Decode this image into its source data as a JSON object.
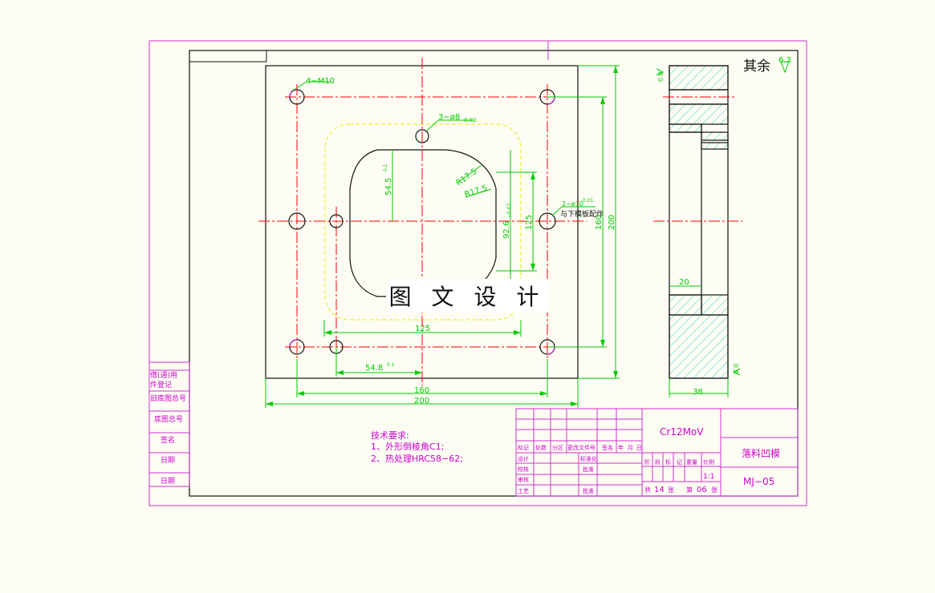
{
  "colors": {
    "background": "#fdfdf3",
    "border": "#cc33cc",
    "outline": "#111111",
    "centerline": "#ff0000",
    "dimension": "#00cc00",
    "yellow_line": "#eeee33",
    "hatch": "#33cccc",
    "note": "#cc00cc"
  },
  "watermark": "图 文 设 计",
  "roughness": {
    "label": "其余",
    "value": "6.3"
  },
  "side_view": {
    "dim_width": "38",
    "dim_step": "20",
    "roughness_top": "0.8",
    "roughness_bottom": "0.8"
  },
  "front_view": {
    "label_holes_m10": "4−M10",
    "label_holes_pin8": "3−ø8",
    "label_holes_pin8_tol": "0.02",
    "label_pin10": "2−ø10",
    "label_pin10_tol": "0.01",
    "label_pin10_note": "与下模板配作",
    "label_r17_a": "R17.5",
    "label_r17_b": "R17.5",
    "dim_54_5": "54.5",
    "dim_54_5_tol": "0.1",
    "dim_92": "92.6",
    "dim_92_tol": "−0.02",
    "dim_125_v": "125",
    "dim_160_v": "160",
    "dim_200_v": "200",
    "dim_125_h": "125",
    "dim_54_8": "54.8",
    "dim_54_8_tol": "0.1",
    "dim_160_h": "160",
    "dim_200_h": "200"
  },
  "notes": {
    "title": "技术要求:",
    "line1": "1、外形倒棱角C1;",
    "line2": "2、热处理HRC58−62;"
  },
  "left_strip": [
    "借(通)用",
    "件登记",
    "旧底图总号",
    "底图总号",
    "签名",
    "日期",
    "日期"
  ],
  "title_block": {
    "material": "Cr12MoV",
    "part_name": "落料凹模",
    "drawing_no": "MJ−05",
    "scale": "1:1",
    "sheets_total_label": "共",
    "sheets_total": "14",
    "sheets_unit": "张",
    "sheet_no_label": "第",
    "sheet_no": "06",
    "sheet_no_unit": "张",
    "rev_headers": [
      "标记",
      "处数",
      "分区",
      "更改文件号",
      "签名",
      "年",
      "月",
      "日"
    ],
    "sign_rows": [
      "设计",
      "校核",
      "审核",
      "工艺"
    ],
    "sign_rows_right": [
      "标准化",
      "批准",
      "",
      "批准"
    ],
    "mid_headers": [
      "阶",
      "段",
      "标",
      "记",
      "重量",
      "比例"
    ]
  }
}
